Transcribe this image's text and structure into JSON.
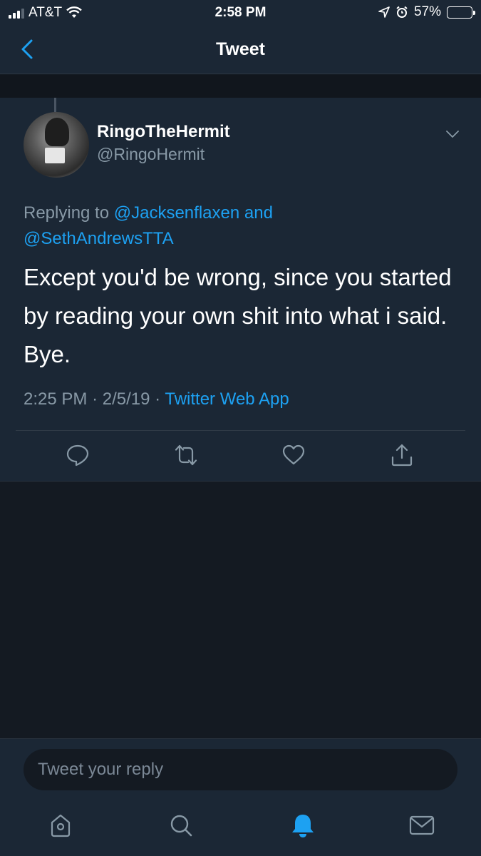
{
  "status_bar": {
    "carrier": "AT&T",
    "time": "2:58 PM",
    "battery_percent": "57%",
    "battery_level": 0.57,
    "icons": [
      "signal-icon",
      "wifi-icon",
      "location-icon",
      "alarm-icon",
      "battery-icon"
    ]
  },
  "nav": {
    "title": "Tweet",
    "back_icon": "chevron-left-icon"
  },
  "tweet": {
    "author_name": "RingoTheHermit",
    "author_handle": "@RingoHermit",
    "replying_prefix": "Replying to",
    "reply_user_1": "@Jacksenflaxen",
    "reply_and": "and",
    "reply_user_2": "@SethAndrewsTTA",
    "text": "Except you'd be wrong, since you started by reading your own shit into what i said. Bye.",
    "time": "2:25 PM",
    "separator": "·",
    "date": "2/5/19",
    "source": "Twitter Web App",
    "actions": [
      "reply-icon",
      "retweet-icon",
      "like-icon",
      "share-icon"
    ]
  },
  "reply_bar": {
    "placeholder": "Tweet your reply"
  },
  "tab_bar": {
    "tabs": [
      "home-icon",
      "search-icon",
      "notifications-icon",
      "messages-icon"
    ],
    "active": "notifications-icon"
  },
  "colors": {
    "background": "#141a22",
    "panel": "#1b2735",
    "accent": "#1da1f2",
    "secondary_text": "#8899a6",
    "battery_fill": "#f4c430"
  }
}
